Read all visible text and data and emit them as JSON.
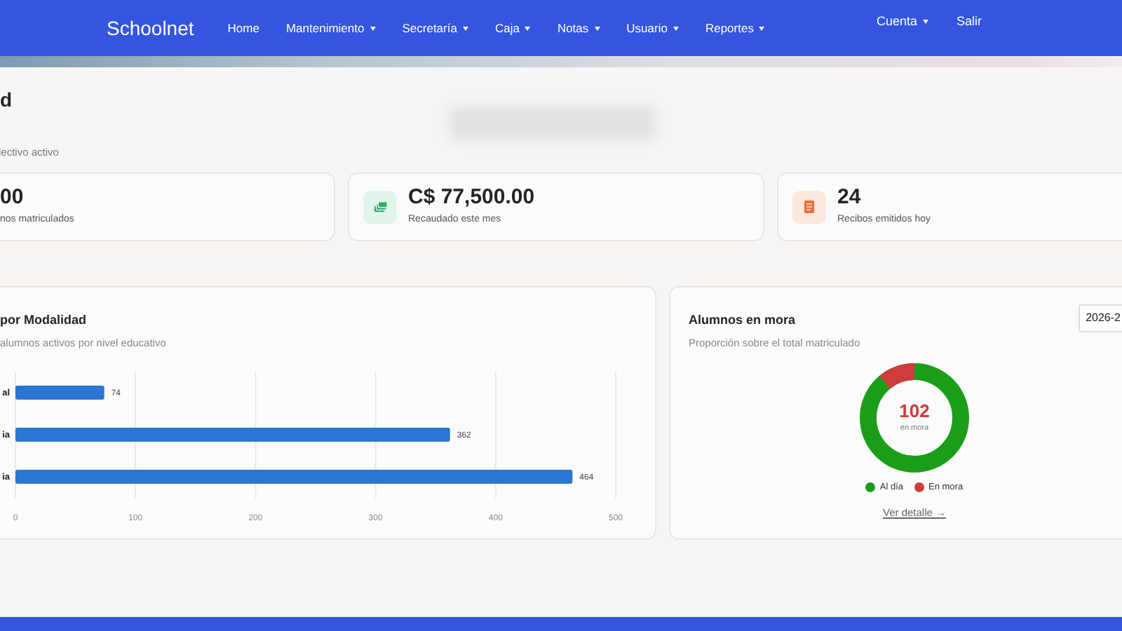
{
  "navbar": {
    "brand": "Schoolnet",
    "items": [
      {
        "label": "Home",
        "dropdown": false
      },
      {
        "label": "Mantenimiento",
        "dropdown": true
      },
      {
        "label": "Secretaría",
        "dropdown": true
      },
      {
        "label": "Caja",
        "dropdown": true
      },
      {
        "label": "Notas",
        "dropdown": true
      },
      {
        "label": "Usuario",
        "dropdown": true
      },
      {
        "label": "Reportes",
        "dropdown": true
      }
    ],
    "right_items": [
      {
        "label": "Cuenta",
        "dropdown": true
      },
      {
        "label": "Salir",
        "dropdown": false
      }
    ]
  },
  "page": {
    "title": "d",
    "subtitle": "lectivo activo"
  },
  "stats": [
    {
      "value": "00",
      "label": "nos matriculados"
    },
    {
      "value": "C$ 77,500.00",
      "label": "Recaudado este mes"
    },
    {
      "value": "24",
      "label": "Recibos emitidos hoy"
    }
  ],
  "modalidad_card": {
    "title": "por Modalidad",
    "subtitle": "alumnos activos por nivel educativo",
    "chart_data": {
      "type": "bar",
      "orientation": "horizontal",
      "categories": [
        "al",
        "ia",
        "ia"
      ],
      "values": [
        74,
        362,
        464
      ],
      "xlim": [
        0,
        500
      ],
      "xticks": [
        0,
        100,
        200,
        300,
        400,
        500
      ],
      "grid": true,
      "data_labels": true
    }
  },
  "mora_card": {
    "title": "Alumnos en mora",
    "subtitle": "Proporción sobre el total matriculado",
    "year": "2026-2",
    "center_value": "102",
    "center_label": "en mora",
    "legend": [
      {
        "label": "Al día",
        "color": "#1a9e1a"
      },
      {
        "label": "En mora",
        "color": "#d13b3b"
      }
    ],
    "link": "Ver detalle →"
  }
}
